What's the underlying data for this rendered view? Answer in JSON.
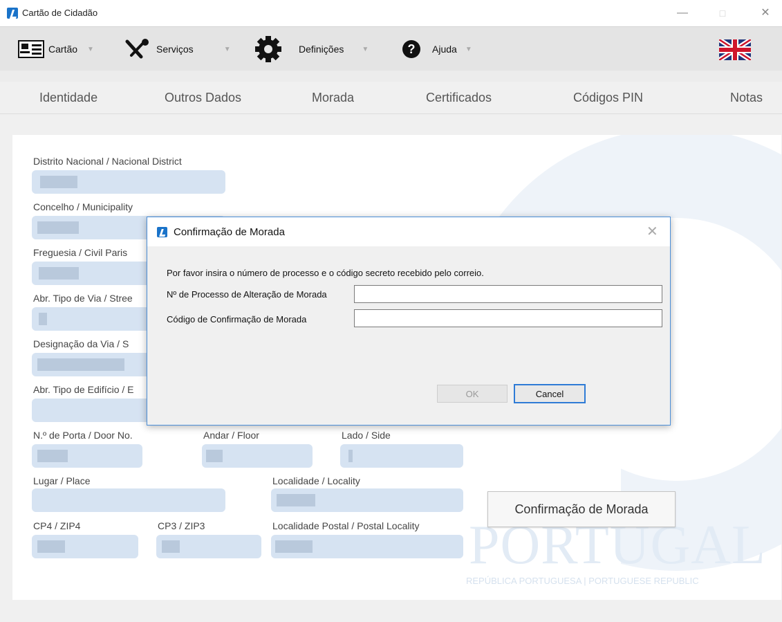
{
  "window": {
    "title": "Cartão de Cidadão",
    "minimize": "—",
    "maximize": "□",
    "close": "✕"
  },
  "menu": [
    {
      "label": "Cartão",
      "icon": "card-icon"
    },
    {
      "label": "Serviços",
      "icon": "tools-icon"
    },
    {
      "label": "Definições",
      "icon": "gear-icon"
    },
    {
      "label": "Ajuda",
      "icon": "help-icon"
    }
  ],
  "language_flag": "uk-flag-icon",
  "tabs": [
    "Identidade",
    "Outros Dados",
    "Morada",
    "Certificados",
    "Códigos PIN",
    "Notas"
  ],
  "form": {
    "distrito": "Distrito Nacional / Nacional District",
    "concelho": "Concelho / Municipality",
    "freguesia": "Freguesia / Civil Paris",
    "tipo_via": "Abr. Tipo de Via / Stree",
    "designacao_via": "Designação da Via / S",
    "tipo_edificio": "Abr. Tipo de Edifício / E",
    "porta": "N.º de Porta / Door No.",
    "andar": "Andar / Floor",
    "lado": "Lado / Side",
    "lugar": "Lugar / Place",
    "localidade": "Localidade / Locality",
    "cp4": "CP4 / ZIP4",
    "cp3": "CP3 / ZIP3",
    "localidade_postal": "Localidade Postal / Postal Locality"
  },
  "confirm_button": "Confirmação de Morada",
  "branding": {
    "wordmark": "PORTUGAL",
    "subtitle": "REPÚBLICA PORTUGUESA | PORTUGUESE REPUBLIC"
  },
  "dialog": {
    "title": "Confirmação de Morada",
    "close": "✕",
    "instructions": "Por favor insira o número de processo e o código secreto recebido pelo correio.",
    "field1_label": "Nº de Processo de Alteração de Morada",
    "field1_value": "",
    "field2_label": "Código de Confirmação de Morada",
    "field2_value": "",
    "ok": "OK",
    "cancel": "Cancel"
  }
}
